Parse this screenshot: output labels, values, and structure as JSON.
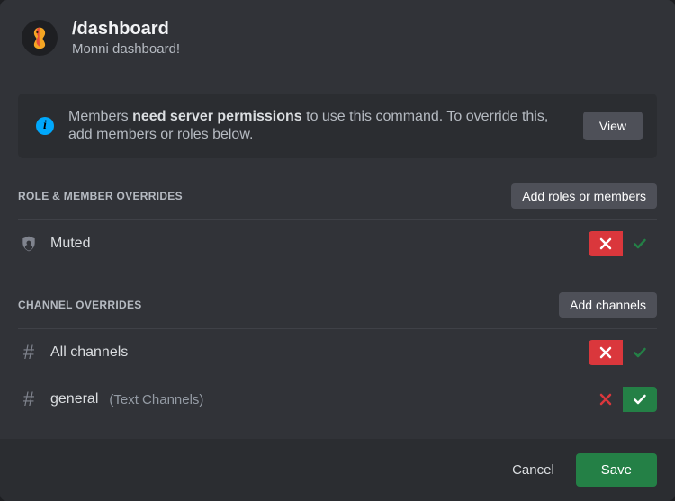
{
  "header": {
    "command": "/dashboard",
    "subtitle": "Monni dashboard!"
  },
  "banner": {
    "text_pre": "Members ",
    "text_strong": "need server permissions",
    "text_post": " to use this command. To override this, add members or roles below.",
    "view_label": "View"
  },
  "sections": {
    "roles": {
      "heading": "ROLE & MEMBER OVERRIDES",
      "add_label": "Add roles or members",
      "items": [
        {
          "name": "Muted",
          "deny_selected": true
        }
      ]
    },
    "channels": {
      "heading": "CHANNEL OVERRIDES",
      "add_label": "Add channels",
      "items": [
        {
          "name": "All channels",
          "category": "",
          "deny_selected": true
        },
        {
          "name": "general",
          "category": "(Text Channels)",
          "deny_selected": false
        }
      ]
    }
  },
  "footer": {
    "cancel": "Cancel",
    "save": "Save"
  }
}
